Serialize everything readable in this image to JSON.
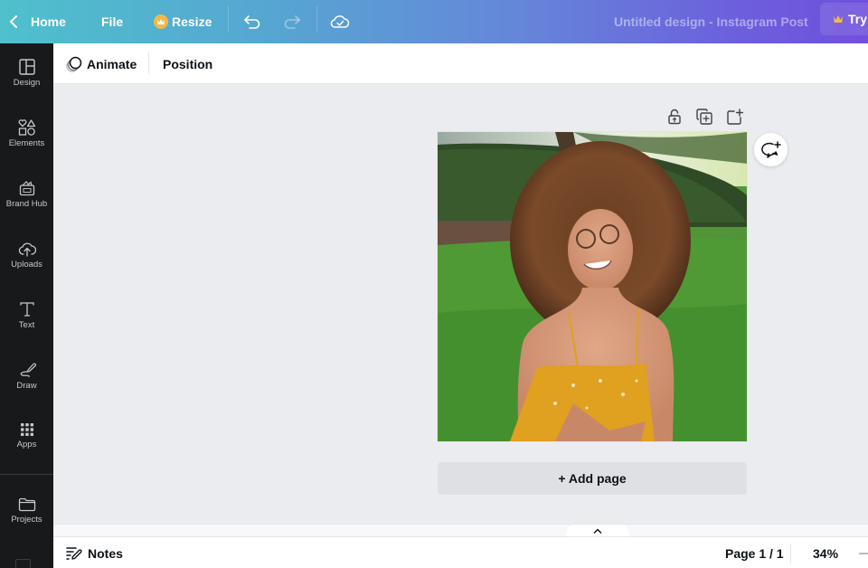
{
  "topbar": {
    "home_label": "Home",
    "file_label": "File",
    "resize_label": "Resize",
    "design_title": "Untitled design - Instagram Post",
    "try_label": "Try",
    "icons": [
      "chevron-left-icon",
      "crown-icon",
      "undo-icon",
      "redo-icon",
      "cloud-saved-icon"
    ]
  },
  "sidebar": {
    "items": [
      {
        "label": "Design",
        "icon": "layout-icon"
      },
      {
        "label": "Elements",
        "icon": "shapes-icon"
      },
      {
        "label": "Brand Hub",
        "icon": "brand-kit-icon"
      },
      {
        "label": "Uploads",
        "icon": "cloud-upload-icon"
      },
      {
        "label": "Text",
        "icon": "text-icon"
      },
      {
        "label": "Draw",
        "icon": "draw-icon"
      },
      {
        "label": "Apps",
        "icon": "apps-grid-icon"
      },
      {
        "label": "Projects",
        "icon": "folder-icon"
      }
    ]
  },
  "context_toolbar": {
    "animate_label": "Animate",
    "position_label": "Position"
  },
  "canvas": {
    "page_tools": [
      "lock-icon",
      "duplicate-page-icon",
      "add-page-icon"
    ],
    "image_description": "Photo of a smiling woman with curly hair and glasses in a yellow floral dress sitting on grass",
    "add_page_label": "+ Add page",
    "comment_icon": "add-comment-icon"
  },
  "footer": {
    "notes_label": "Notes",
    "page_indicator": "Page 1 / 1",
    "zoom_level": "34%"
  }
}
